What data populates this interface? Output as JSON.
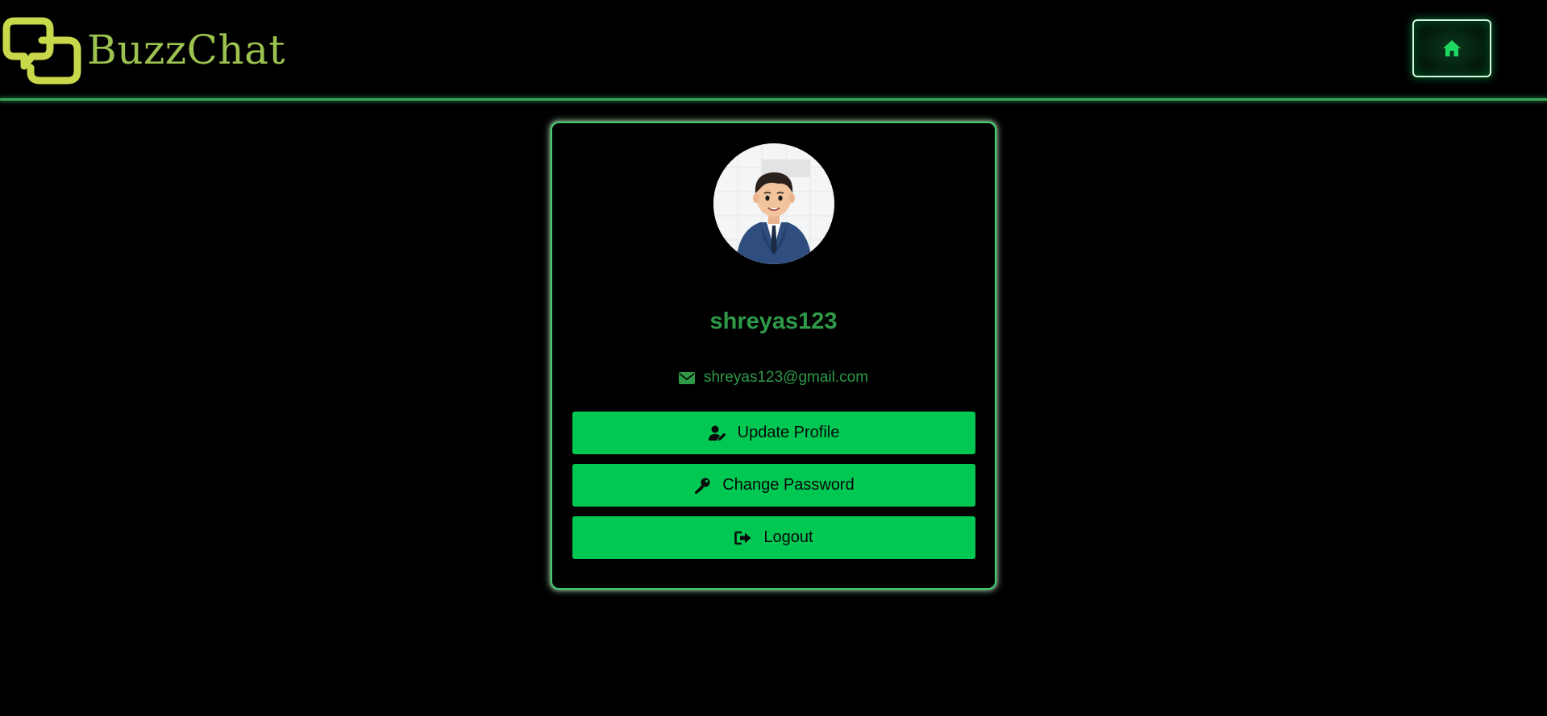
{
  "header": {
    "brand_name": "BuzzChat",
    "logo_icon": "speech-bubbles-logo",
    "home_icon": "home-icon",
    "accent_color": "#9cc24f"
  },
  "profile": {
    "username": "shreyas123",
    "email": "shreyas123@gmail.com",
    "email_icon": "envelope-icon",
    "avatar": "avatar-image"
  },
  "actions": {
    "update_profile": "Update Profile",
    "change_password": "Change Password",
    "logout": "Logout"
  },
  "colors": {
    "background": "#000000",
    "primary_button": "#00c853",
    "text_green": "#2e9a48",
    "border_green": "#3ecf6c"
  }
}
